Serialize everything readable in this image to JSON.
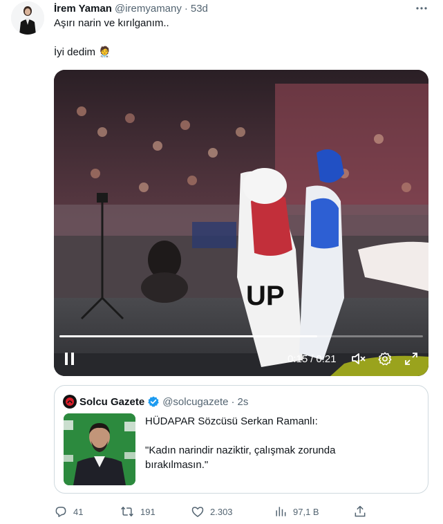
{
  "tweet": {
    "author_name": "İrem Yaman",
    "author_handle": "@iremyamany",
    "separator": "·",
    "time": "53d",
    "text_line1": "Aşırı narin ve kırılganım..",
    "text_line2": "İyi dedim",
    "emoji": "🧑‍⚕️",
    "more_icon": "more-horizontal-icon"
  },
  "video": {
    "current_time": "0:15",
    "divider": "/",
    "duration": "0:21",
    "progress": 0.71,
    "play_state": "paused",
    "jersey_text": "UP",
    "colors": {
      "accent": "#ffffff"
    }
  },
  "quote": {
    "source_name": "Solcu Gazete",
    "source_handle": "@solcugazete",
    "separator": "·",
    "time": "2s",
    "verified": true,
    "line1": "HÜDAPAR Sözcüsü Serkan Ramanlı:",
    "line2": "\"Kadın narindir naziktir, çalışmak zorunda",
    "line3": "bırakılmasın.\"",
    "colors": {
      "verified": "#1d9bf0",
      "thumb_bg": "#2c8a3e"
    }
  },
  "actions": {
    "replies": "41",
    "retweets": "191",
    "likes": "2.303",
    "views": "97,1 B",
    "colors": {
      "icon": "#536471"
    }
  }
}
